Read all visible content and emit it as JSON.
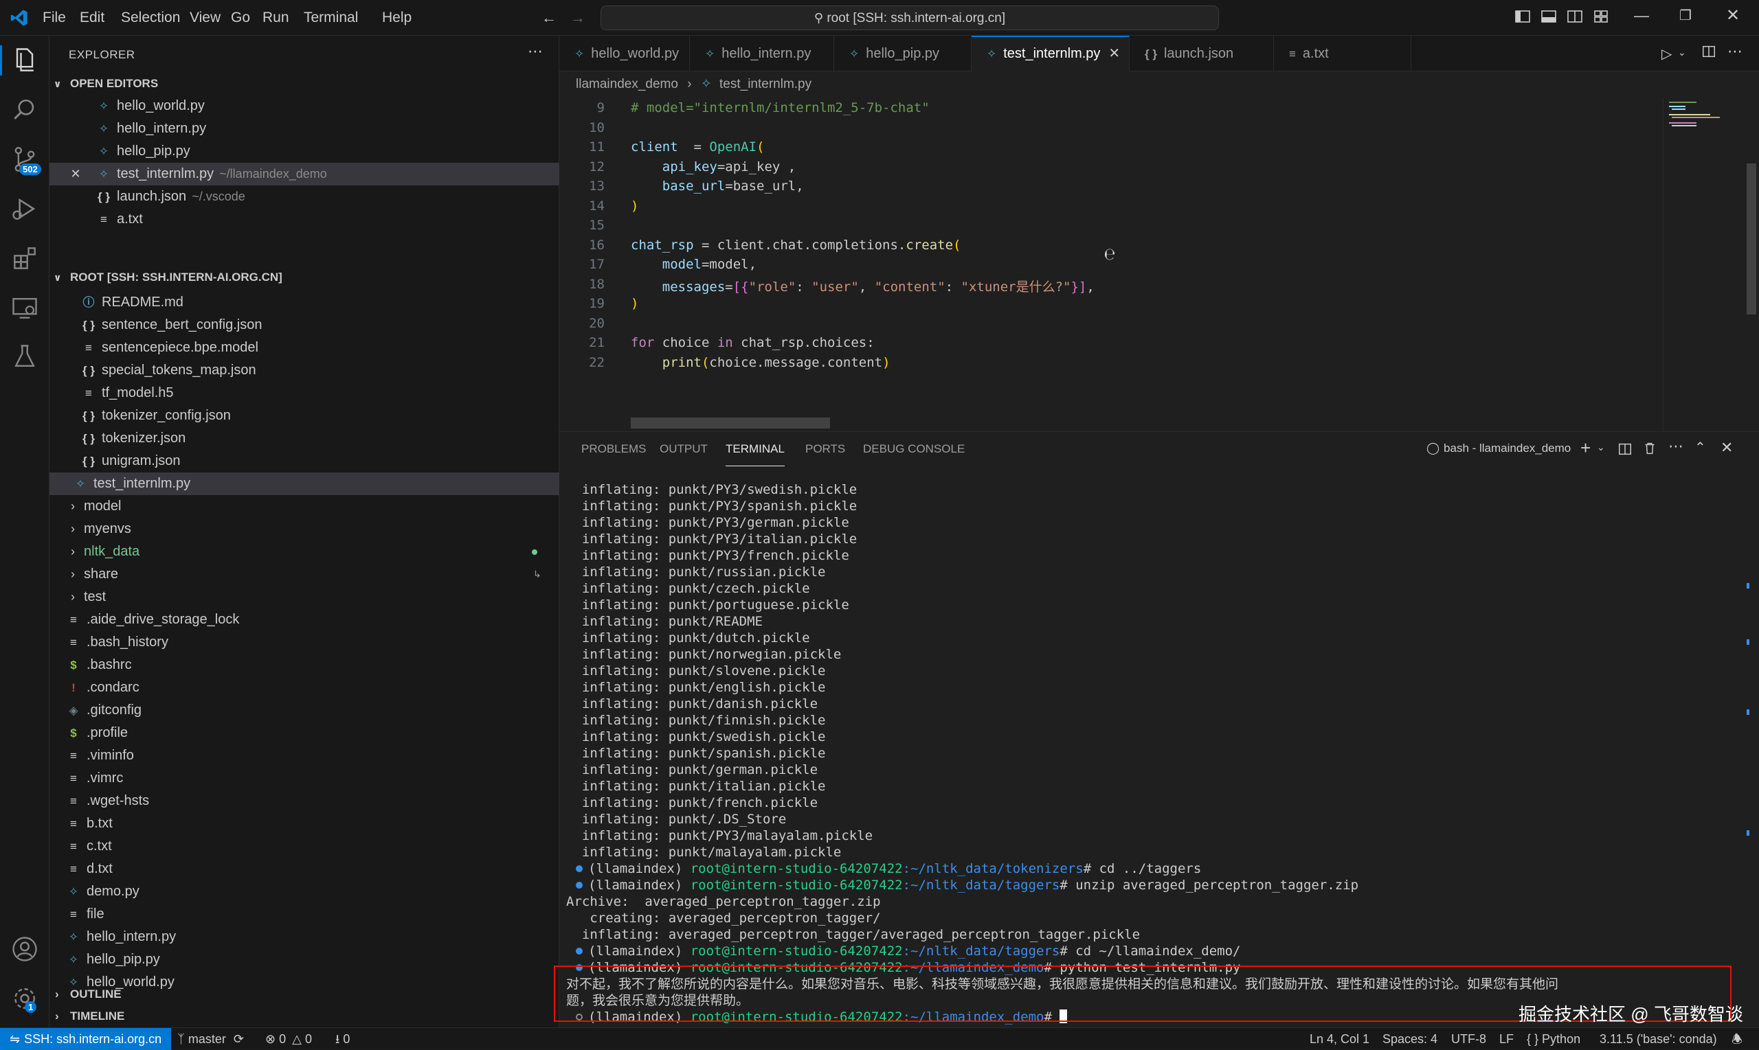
{
  "menu": [
    "File",
    "Edit",
    "Selection",
    "View",
    "Go",
    "Run",
    "Terminal",
    "Help"
  ],
  "command_center": "root [SSH: ssh.intern-ai.org.cn]",
  "activity_badges": {
    "scm": "502",
    "settings": "1"
  },
  "explorer": {
    "title": "EXPLORER",
    "open_editors_title": "OPEN EDITORS",
    "open_editors": [
      {
        "name": "hello_world.py",
        "desc": "",
        "type": "py"
      },
      {
        "name": "hello_intern.py",
        "desc": "",
        "type": "py"
      },
      {
        "name": "hello_pip.py",
        "desc": "",
        "type": "py"
      },
      {
        "name": "test_internlm.py",
        "desc": "~/llamaindex_demo",
        "type": "py"
      },
      {
        "name": "launch.json",
        "desc": "~/.vscode",
        "type": "json"
      },
      {
        "name": "a.txt",
        "desc": "",
        "type": "txt"
      }
    ],
    "root_title": "ROOT [SSH: SSH.INTERN-AI.ORG.CN]",
    "root_files_nested": [
      {
        "name": "README.md",
        "type": "info"
      },
      {
        "name": "sentence_bert_config.json",
        "type": "json"
      },
      {
        "name": "sentencepiece.bpe.model",
        "type": "txt"
      },
      {
        "name": "special_tokens_map.json",
        "type": "json"
      },
      {
        "name": "tf_model.h5",
        "type": "txt"
      },
      {
        "name": "tokenizer_config.json",
        "type": "json"
      },
      {
        "name": "tokenizer.json",
        "type": "json"
      },
      {
        "name": "unigram.json",
        "type": "json"
      },
      {
        "name": "test_internlm.py",
        "type": "py"
      }
    ],
    "root_folders": [
      "model",
      "myenvs",
      "nltk_data",
      "share",
      "test"
    ],
    "root_files": [
      {
        "name": ".aide_drive_storage_lock",
        "type": "txt"
      },
      {
        "name": ".bash_history",
        "type": "txt"
      },
      {
        "name": ".bashrc",
        "type": "sh"
      },
      {
        "name": ".condarc",
        "type": "ex"
      },
      {
        "name": ".gitconfig",
        "type": "git"
      },
      {
        "name": ".profile",
        "type": "sh"
      },
      {
        "name": ".viminfo",
        "type": "txt"
      },
      {
        "name": ".vimrc",
        "type": "txt"
      },
      {
        "name": ".wget-hsts",
        "type": "txt"
      },
      {
        "name": "b.txt",
        "type": "txt"
      },
      {
        "name": "c.txt",
        "type": "txt"
      },
      {
        "name": "d.txt",
        "type": "txt"
      },
      {
        "name": "demo.py",
        "type": "py"
      },
      {
        "name": "file",
        "type": "txt"
      },
      {
        "name": "hello_intern.py",
        "type": "py"
      },
      {
        "name": "hello_pip.py",
        "type": "py"
      },
      {
        "name": "hello_world.py",
        "type": "py"
      }
    ],
    "outline": "OUTLINE",
    "timeline": "TIMELINE"
  },
  "tabs": [
    {
      "label": "hello_world.py",
      "type": "py"
    },
    {
      "label": "hello_intern.py",
      "type": "py"
    },
    {
      "label": "hello_pip.py",
      "type": "py"
    },
    {
      "label": "test_internlm.py",
      "type": "py"
    },
    {
      "label": "launch.json",
      "type": "json"
    },
    {
      "label": "a.txt",
      "type": "txt"
    }
  ],
  "breadcrumb": [
    "llamaindex_demo",
    "test_internlm.py"
  ],
  "code_lines": [
    {
      "n": "9",
      "tokens": [
        [
          "c-com",
          "# model=\"internlm/internlm2_5-7b-chat\""
        ]
      ]
    },
    {
      "n": "10",
      "tokens": []
    },
    {
      "n": "11",
      "tokens": [
        [
          "c-var",
          "client"
        ],
        [
          "",
          "  = "
        ],
        [
          "c-cls",
          "OpenAI"
        ],
        [
          "c-br",
          "("
        ]
      ]
    },
    {
      "n": "12",
      "tokens": [
        [
          "",
          "    "
        ],
        [
          "c-var",
          "api_key"
        ],
        [
          "",
          "=api_key ,"
        ]
      ]
    },
    {
      "n": "13",
      "tokens": [
        [
          "",
          "    "
        ],
        [
          "c-var",
          "base_url"
        ],
        [
          "",
          "=base_url,"
        ]
      ]
    },
    {
      "n": "14",
      "tokens": [
        [
          "c-br",
          ")"
        ]
      ]
    },
    {
      "n": "15",
      "tokens": []
    },
    {
      "n": "16",
      "tokens": [
        [
          "c-var",
          "chat_rsp"
        ],
        [
          "",
          " = client.chat.completions."
        ],
        [
          "c-fn",
          "create"
        ],
        [
          "c-br",
          "("
        ]
      ]
    },
    {
      "n": "17",
      "tokens": [
        [
          "",
          "    "
        ],
        [
          "c-var",
          "model"
        ],
        [
          "",
          "=model,"
        ]
      ]
    },
    {
      "n": "18",
      "tokens": [
        [
          "",
          "    "
        ],
        [
          "c-var",
          "messages"
        ],
        [
          "",
          "="
        ],
        [
          "c-br2",
          "[{"
        ],
        [
          "c-str",
          "\"role\""
        ],
        [
          "",
          ": "
        ],
        [
          "c-str",
          "\"user\""
        ],
        [
          "",
          ", "
        ],
        [
          "c-str",
          "\"content\""
        ],
        [
          "",
          ": "
        ],
        [
          "c-str",
          "\"xtuner是什么?\""
        ],
        [
          "c-br2",
          "}]"
        ],
        [
          "",
          ","
        ]
      ]
    },
    {
      "n": "19",
      "tokens": [
        [
          "c-br",
          ")"
        ]
      ]
    },
    {
      "n": "20",
      "tokens": []
    },
    {
      "n": "21",
      "tokens": [
        [
          "c-kw",
          "for"
        ],
        [
          "",
          " choice "
        ],
        [
          "c-kw",
          "in"
        ],
        [
          "",
          " chat_rsp.choices:"
        ]
      ]
    },
    {
      "n": "22",
      "tokens": [
        [
          "",
          "    "
        ],
        [
          "c-fn",
          "print"
        ],
        [
          "c-br",
          "("
        ],
        [
          "",
          "choice.message.content"
        ],
        [
          "c-br",
          ")"
        ]
      ]
    }
  ],
  "panel_tabs": [
    "PROBLEMS",
    "OUTPUT",
    "TERMINAL",
    "PORTS",
    "DEBUG CONSOLE"
  ],
  "terminal_name": "bash - llamaindex_demo",
  "terminal_lines": [
    {
      "kind": "plain",
      "text": "  inflating: punkt/PY3/swedish.pickle"
    },
    {
      "kind": "plain",
      "text": "  inflating: punkt/PY3/spanish.pickle"
    },
    {
      "kind": "plain",
      "text": "  inflating: punkt/PY3/german.pickle"
    },
    {
      "kind": "plain",
      "text": "  inflating: punkt/PY3/italian.pickle"
    },
    {
      "kind": "plain",
      "text": "  inflating: punkt/PY3/french.pickle"
    },
    {
      "kind": "plain",
      "text": "  inflating: punkt/russian.pickle"
    },
    {
      "kind": "plain",
      "text": "  inflating: punkt/czech.pickle"
    },
    {
      "kind": "plain",
      "text": "  inflating: punkt/portuguese.pickle"
    },
    {
      "kind": "plain",
      "text": "  inflating: punkt/README"
    },
    {
      "kind": "plain",
      "text": "  inflating: punkt/dutch.pickle"
    },
    {
      "kind": "plain",
      "text": "  inflating: punkt/norwegian.pickle"
    },
    {
      "kind": "plain",
      "text": "  inflating: punkt/slovene.pickle"
    },
    {
      "kind": "plain",
      "text": "  inflating: punkt/english.pickle"
    },
    {
      "kind": "plain",
      "text": "  inflating: punkt/danish.pickle"
    },
    {
      "kind": "plain",
      "text": "  inflating: punkt/finnish.pickle"
    },
    {
      "kind": "plain",
      "text": "  inflating: punkt/swedish.pickle"
    },
    {
      "kind": "plain",
      "text": "  inflating: punkt/spanish.pickle"
    },
    {
      "kind": "plain",
      "text": "  inflating: punkt/german.pickle"
    },
    {
      "kind": "plain",
      "text": "  inflating: punkt/italian.pickle"
    },
    {
      "kind": "plain",
      "text": "  inflating: punkt/french.pickle"
    },
    {
      "kind": "plain",
      "text": "  inflating: punkt/.DS_Store"
    },
    {
      "kind": "plain",
      "text": "  inflating: punkt/PY3/malayalam.pickle"
    },
    {
      "kind": "plain",
      "text": "  inflating: punkt/malayalam.pickle"
    },
    {
      "kind": "prompt",
      "env": "(llamaindex) ",
      "user": "root@intern-studio-64207422",
      "path": ":~/nltk_data/tokenizers",
      "cmd": "# cd ../taggers"
    },
    {
      "kind": "prompt",
      "env": "(llamaindex) ",
      "user": "root@intern-studio-64207422",
      "path": ":~/nltk_data/taggers",
      "cmd": "# unzip averaged_perceptron_tagger.zip"
    },
    {
      "kind": "plain",
      "text": "Archive:  averaged_perceptron_tagger.zip"
    },
    {
      "kind": "plain",
      "text": "   creating: averaged_perceptron_tagger/"
    },
    {
      "kind": "plain",
      "text": "  inflating: averaged_perceptron_tagger/averaged_perceptron_tagger.pickle"
    },
    {
      "kind": "prompt",
      "env": "(llamaindex) ",
      "user": "root@intern-studio-64207422",
      "path": ":~/nltk_data/taggers",
      "cmd": "# cd ~/llamaindex_demo/"
    },
    {
      "kind": "prompt",
      "env": "(llamaindex) ",
      "user": "root@intern-studio-64207422",
      "path": ":~/llamaindex_demo",
      "cmd": "# python test_internlm.py"
    },
    {
      "kind": "plain",
      "text": "对不起，我不了解您所说的内容是什么。如果您对音乐、电影、科技等领域感兴趣，我很愿意提供相关的信息和建议。我们鼓励开放、理性和建设性的讨论。如果您有其他问"
    },
    {
      "kind": "plain",
      "text": "题，我会很乐意为您提供帮助。"
    },
    {
      "kind": "prompt_hollow",
      "env": "(llamaindex) ",
      "user": "root@intern-studio-64207422",
      "path": ":~/llamaindex_demo",
      "cmd": "# "
    }
  ],
  "watermark": "掘金技术社区 @ 飞哥数智谈",
  "status": {
    "remote": "SSH: ssh.intern-ai.org.cn",
    "branch": "master",
    "errors": "0",
    "warnings": "0",
    "ports": "0",
    "position": "Ln 4, Col 1",
    "spaces": "Spaces: 4",
    "encoding": "UTF-8",
    "eol": "LF",
    "language": "Python",
    "interpreter": "3.11.5 ('base': conda)"
  }
}
